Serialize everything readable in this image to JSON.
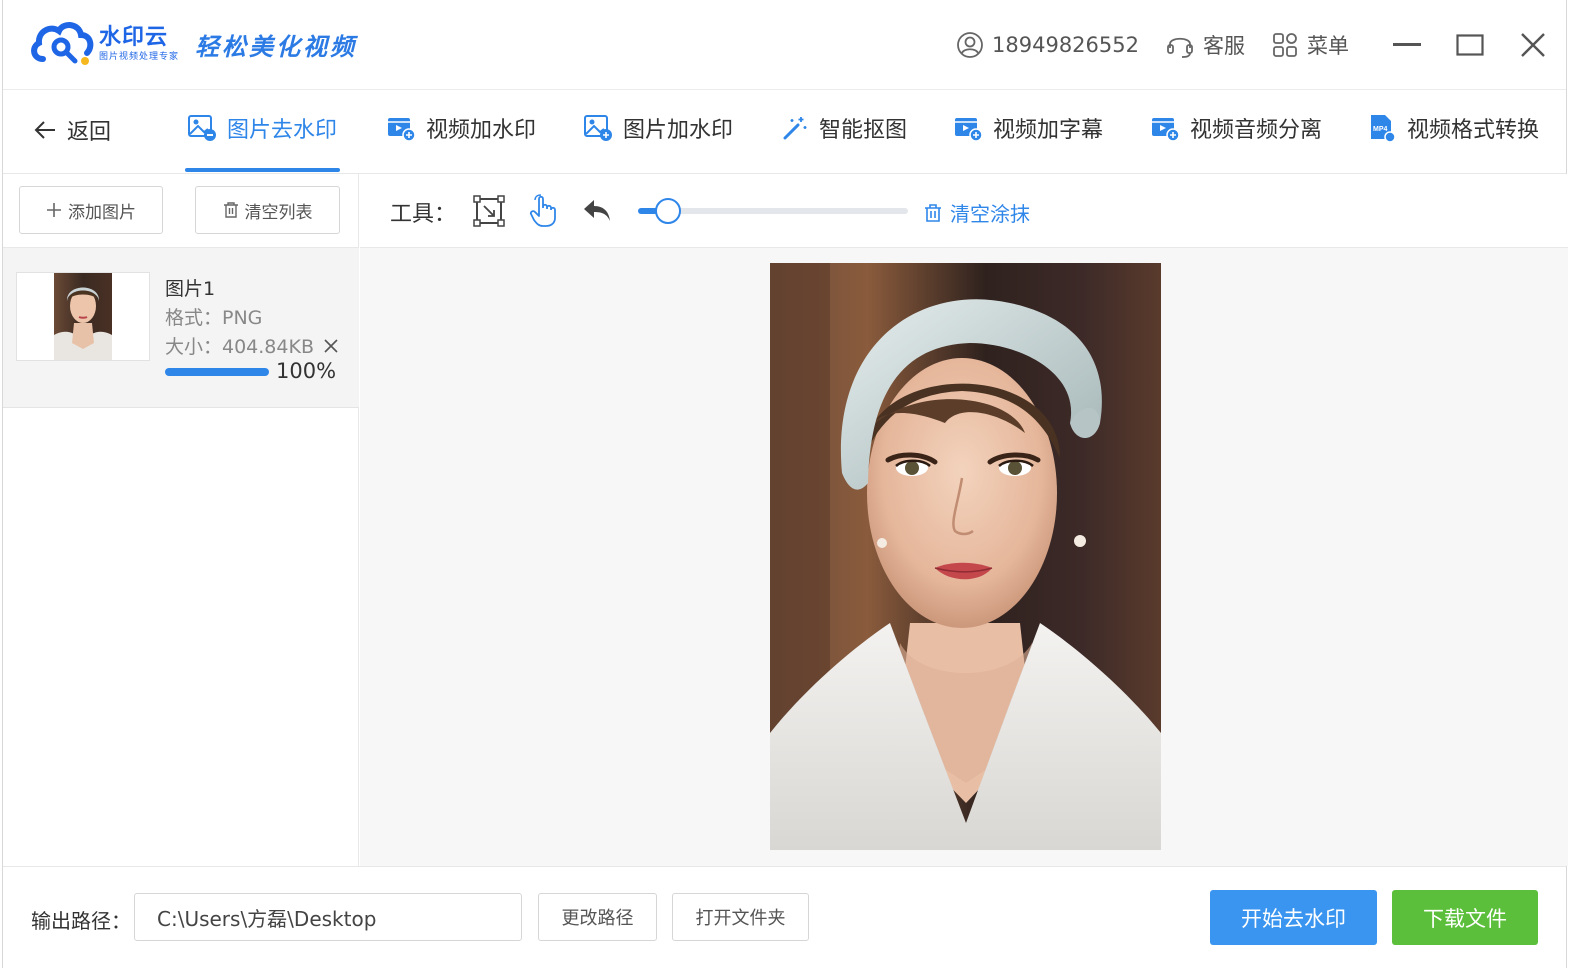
{
  "app": {
    "name": "水印云",
    "subtitle": "图片视频处理专家",
    "slogan": "轻松美化视频",
    "brand_color": "#1f66e6",
    "accent_color": "#2f86e9"
  },
  "header": {
    "user_phone": "18949826552",
    "service_label": "客服",
    "menu_label": "菜单"
  },
  "nav": {
    "back_label": "返回",
    "tabs": [
      {
        "label": "图片去水印",
        "icon": "image-remove-icon",
        "active": true
      },
      {
        "label": "视频加水印",
        "icon": "video-add-icon",
        "active": false
      },
      {
        "label": "图片加水印",
        "icon": "image-add-icon",
        "active": false
      },
      {
        "label": "智能抠图",
        "icon": "magic-wand-icon",
        "active": false
      },
      {
        "label": "视频加字幕",
        "icon": "video-subtitle-icon",
        "active": false
      },
      {
        "label": "视频音频分离",
        "icon": "video-audio-icon",
        "active": false
      },
      {
        "label": "视频格式转换",
        "icon": "mp4-convert-icon",
        "active": false
      }
    ]
  },
  "left_panel": {
    "add_image_label": "添加图片",
    "clear_list_label": "清空列表",
    "files": [
      {
        "name": "图片1",
        "format": "格式：PNG",
        "size": "大小：404.84KB",
        "progress": "100%",
        "progress_value": 1.0
      }
    ]
  },
  "toolbar": {
    "label": "工具：",
    "brush_size_value": 0.11,
    "clear_smear_label": "清空涂抹"
  },
  "bottom": {
    "output_path_label": "输出路径：",
    "output_path_value": "C:\\Users\\方磊\\Desktop",
    "change_path_label": "更改路径",
    "open_folder_label": "打开文件夹",
    "start_button_label": "开始去水印",
    "download_button_label": "下载文件",
    "start_button_color": "#3a95f0",
    "download_button_color": "#5cbf3c"
  }
}
